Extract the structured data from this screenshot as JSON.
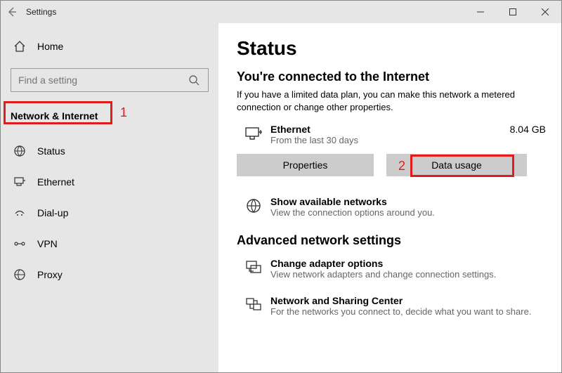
{
  "window": {
    "title": "Settings"
  },
  "sidebar": {
    "home_label": "Home",
    "search_placeholder": "Find a setting",
    "section_label": "Network & Internet",
    "items": [
      {
        "label": "Status"
      },
      {
        "label": "Ethernet"
      },
      {
        "label": "Dial-up"
      },
      {
        "label": "VPN"
      },
      {
        "label": "Proxy"
      }
    ]
  },
  "main": {
    "heading": "Status",
    "connected_heading": "You're connected to the Internet",
    "connected_desc": "If you have a limited data plan, you can make this network a metered connection or change other properties.",
    "connection": {
      "name": "Ethernet",
      "period": "From the last 30 days",
      "usage": "8.04 GB"
    },
    "buttons": {
      "properties": "Properties",
      "data_usage": "Data usage"
    },
    "show_networks": {
      "title": "Show available networks",
      "sub": "View the connection options around you."
    },
    "advanced_heading": "Advanced network settings",
    "adapter": {
      "title": "Change adapter options",
      "sub": "View network adapters and change connection settings."
    },
    "sharing": {
      "title": "Network and Sharing Center",
      "sub": "For the networks you connect to, decide what you want to share."
    }
  },
  "annotations": {
    "label1": "1",
    "label2": "2"
  }
}
